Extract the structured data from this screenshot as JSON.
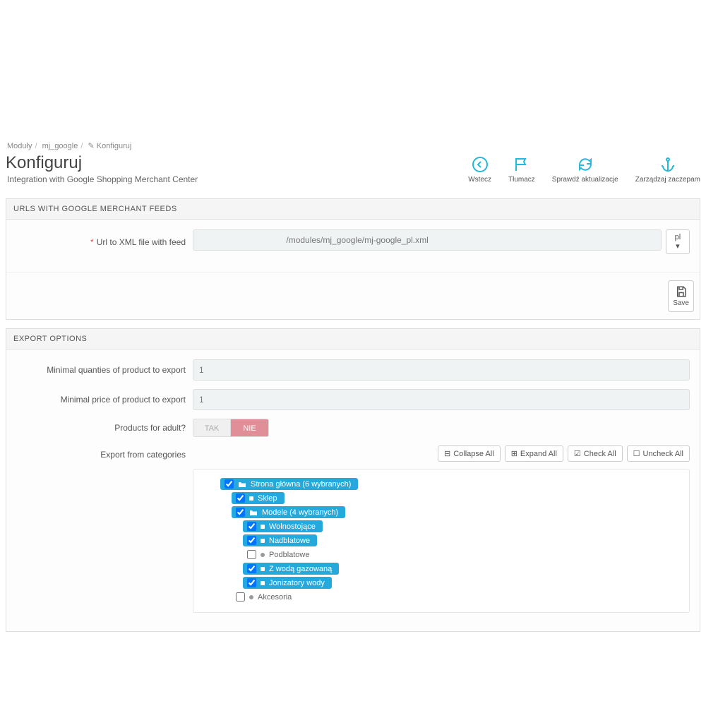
{
  "breadcrumbs": {
    "a": "Moduły",
    "b": "mj_google",
    "c": "Konfiguruj"
  },
  "header": {
    "title": "Konfiguruj",
    "subtitle": "Integration with Google Shopping Merchant Center",
    "actions": {
      "back": "Wstecz",
      "translate": "Tłumacz",
      "check": "Sprawdź aktualizacje",
      "hooks": "Zarządzaj zaczepam"
    }
  },
  "panel1": {
    "title": "URLS WITH GOOGLE MERCHANT FEEDS",
    "label": "Url to XML file with feed",
    "value": "                                     /modules/mj_google/mj-google_pl.xml",
    "langBtn": "pl ▾",
    "save": "Save"
  },
  "panel2": {
    "title": "EXPORT OPTIONS",
    "minQtyLbl": "Minimal quanties of product to export",
    "minQtyVal": "1",
    "minPriceLbl": "Minimal price of product to export",
    "minPriceVal": "1",
    "adultLbl": "Products for adult?",
    "adultYes": "TAK",
    "adultNo": "NIE",
    "catsLbl": "Export from categories",
    "toolbar": {
      "collapse": "Collapse All",
      "expand": "Expand All",
      "check": "Check All",
      "uncheck": "Uncheck All"
    },
    "tree": {
      "root": "Strona główna (6 wybranych)",
      "sklep": "Sklep",
      "modele": "Modele (4 wybranych)",
      "woln": "Wolnostojące",
      "nadb": "Nadblatowe",
      "podb": "Podblatowe",
      "zwod": "Z wodą gazowaną",
      "jon": "Jonizatory wody",
      "akc": "Akcesoria"
    }
  }
}
